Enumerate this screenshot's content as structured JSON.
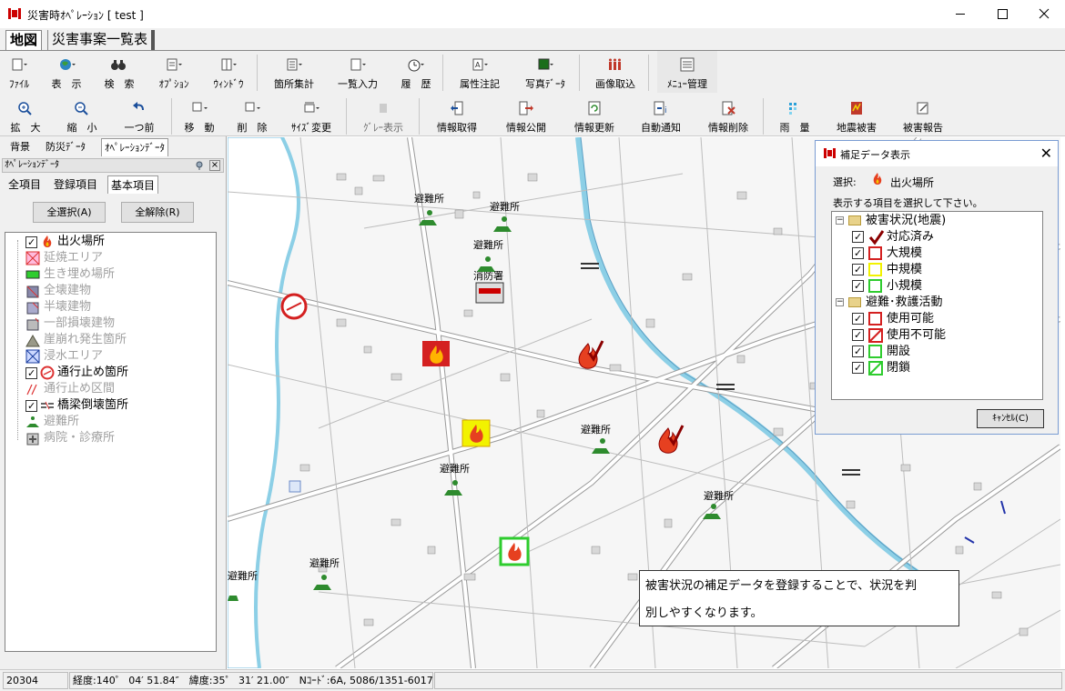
{
  "window": {
    "title": "災害時ｵﾍﾟﾚｰｼｮﾝ [ test ]"
  },
  "main_tabs": [
    {
      "label": "地図"
    },
    {
      "label": "災害事案一覧表"
    }
  ],
  "toolbar1": [
    {
      "label": "ﾌｧｲﾙ",
      "icon": "file-icon"
    },
    {
      "label": "表　示",
      "icon": "globe-icon"
    },
    {
      "label": "検　索",
      "icon": "binoculars-icon"
    },
    {
      "label": "ｵﾌﾟｼｮﾝ",
      "icon": "options-icon"
    },
    {
      "label": "ｳｨﾝﾄﾞｳ",
      "icon": "window-icon"
    },
    {
      "label": "箇所集計",
      "icon": "tally-icon"
    },
    {
      "label": "一覧入力",
      "icon": "list-input-icon"
    },
    {
      "label": "履　歴",
      "icon": "history-icon"
    },
    {
      "label": "属性注記",
      "icon": "attribute-note-icon"
    },
    {
      "label": "写真ﾃﾞｰﾀ",
      "icon": "photo-icon"
    },
    {
      "label": "画像取込",
      "icon": "image-import-icon"
    },
    {
      "label": "ﾒﾆｭｰ管理",
      "icon": "menu-manage-icon"
    }
  ],
  "toolbar2": [
    {
      "label": "拡　大",
      "icon": "zoom-in-icon",
      "enabled": true
    },
    {
      "label": "縮　小",
      "icon": "zoom-out-icon",
      "enabled": true
    },
    {
      "label": "一つ前",
      "icon": "undo-icon",
      "enabled": true
    },
    {
      "label": "移　動",
      "icon": "move-icon",
      "enabled": true
    },
    {
      "label": "削　除",
      "icon": "delete-icon",
      "enabled": true
    },
    {
      "label": "ｻｲｽﾞ変更",
      "icon": "resize-icon",
      "enabled": true
    },
    {
      "label": "ｸﾞﾚｰ表示",
      "icon": "gray-display-icon",
      "enabled": false
    },
    {
      "label": "情報取得",
      "icon": "info-get-icon",
      "enabled": true
    },
    {
      "label": "情報公開",
      "icon": "info-publish-icon",
      "enabled": true
    },
    {
      "label": "情報更新",
      "icon": "info-update-icon",
      "enabled": true
    },
    {
      "label": "自動通知",
      "icon": "auto-notify-icon",
      "enabled": true
    },
    {
      "label": "情報削除",
      "icon": "info-delete-icon",
      "enabled": true
    },
    {
      "label": "雨　量",
      "icon": "rainfall-icon",
      "enabled": true
    },
    {
      "label": "地震被害",
      "icon": "earthquake-icon",
      "enabled": true
    },
    {
      "label": "被害報告",
      "icon": "damage-report-icon",
      "enabled": true
    }
  ],
  "left_panel": {
    "side_tabs": [
      {
        "label": "背景"
      },
      {
        "label": "防災ﾃﾞｰﾀ"
      },
      {
        "label": "ｵﾍﾟﾚｰｼｮﾝﾃﾞｰﾀ"
      }
    ],
    "header": "ｵﾍﾟﾚｰｼｮﾝﾃﾞｰﾀ",
    "inner_tabs": [
      {
        "label": "全項目"
      },
      {
        "label": "登録項目"
      },
      {
        "label": "基本項目"
      }
    ],
    "select_all": "全選択(A)",
    "deselect_all": "全解除(R)",
    "layers": [
      {
        "label": "出火場所",
        "checked": true,
        "icon": "fire-icon"
      },
      {
        "label": "延焼エリア",
        "checked": false,
        "icon": "spread-area-icon"
      },
      {
        "label": "生き埋め場所",
        "checked": false,
        "icon": "buried-icon"
      },
      {
        "label": "全壊建物",
        "checked": false,
        "icon": "collapsed-building-icon"
      },
      {
        "label": "半壊建物",
        "checked": false,
        "icon": "half-collapsed-icon"
      },
      {
        "label": "一部損壊建物",
        "checked": false,
        "icon": "partial-damage-icon"
      },
      {
        "label": "崖崩れ発生箇所",
        "checked": false,
        "icon": "landslide-icon"
      },
      {
        "label": "浸水エリア",
        "checked": false,
        "icon": "flood-area-icon"
      },
      {
        "label": "通行止め箇所",
        "checked": true,
        "icon": "road-closed-icon"
      },
      {
        "label": "通行止め区間",
        "checked": false,
        "icon": "closed-section-icon"
      },
      {
        "label": "橋梁倒壊箇所",
        "checked": true,
        "icon": "bridge-collapse-icon"
      },
      {
        "label": "避難所",
        "checked": false,
        "icon": "shelter-icon"
      },
      {
        "label": "病院・診療所",
        "checked": false,
        "icon": "hospital-icon"
      }
    ]
  },
  "map": {
    "labels": {
      "shelter": "避難所",
      "fire_station": "消防署"
    },
    "colors": {
      "fire_red": "#d42020",
      "shelter_green": "#2e8b2e",
      "river": "#8ccfe6"
    }
  },
  "dialog": {
    "title": "補足データ表示",
    "selection_label": "選択:",
    "selection_value": "出火場所",
    "instruction": "表示する項目を選択して下さい。",
    "groups": [
      {
        "label": "被害状況(地震)",
        "items": [
          {
            "label": "対応済み",
            "marker": "check",
            "color": "#8b0000"
          },
          {
            "label": "大規模",
            "marker": "square",
            "color": "#d42020"
          },
          {
            "label": "中規模",
            "marker": "square",
            "color": "#f2f200"
          },
          {
            "label": "小規模",
            "marker": "square",
            "color": "#2ecc2e"
          }
        ]
      },
      {
        "label": "避難･救護活動",
        "items": [
          {
            "label": "使用可能",
            "marker": "square",
            "color": "#d42020"
          },
          {
            "label": "使用不可能",
            "marker": "slash",
            "color": "#d42020"
          },
          {
            "label": "開設",
            "marker": "square",
            "color": "#2ecc2e"
          },
          {
            "label": "閉鎖",
            "marker": "slash",
            "color": "#2ecc2e"
          }
        ]
      }
    ],
    "cancel": "ｷｬﾝｾﾙ(C)"
  },
  "tooltip": {
    "line1": "被害状況の補足データを登録することで、状況を判",
    "line2": "別しやすくなります。"
  },
  "status_bar": {
    "scale": "20304",
    "coords": "経度:140゜ 04′ 51.84″　緯度:35゜ 31′ 21.00″　Nｺｰﾄﾞ:6A, 5086/1351-6017",
    "extra": ""
  }
}
